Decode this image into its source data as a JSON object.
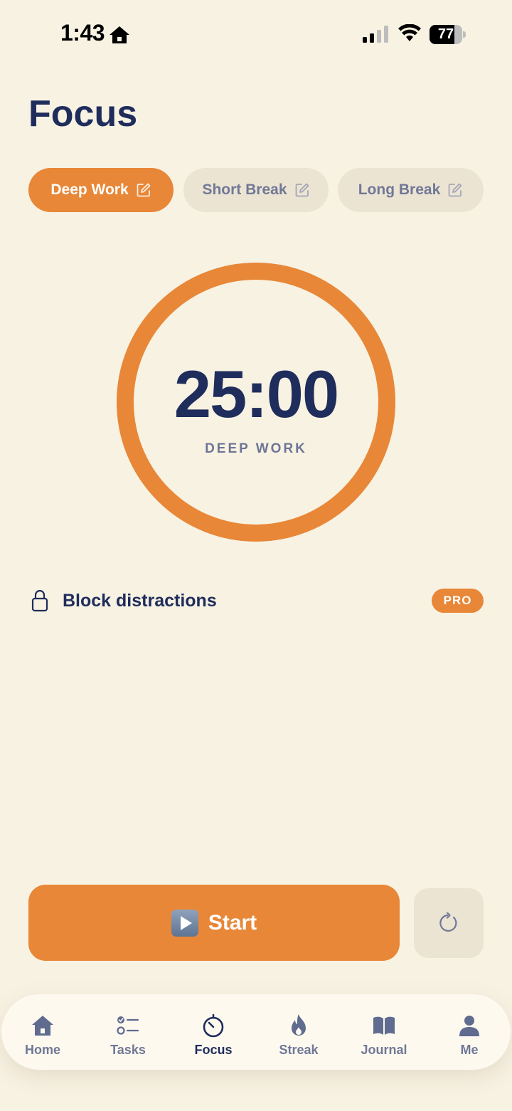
{
  "status_bar": {
    "time": "1:43",
    "battery_percent": 77,
    "battery_text": "77",
    "signal_bars_filled": 2,
    "signal_bars_total": 4
  },
  "page": {
    "title": "Focus"
  },
  "modes": [
    {
      "label": "Deep Work",
      "active": true
    },
    {
      "label": "Short Break",
      "active": false
    },
    {
      "label": "Long Break",
      "active": false
    }
  ],
  "timer": {
    "time": "25:00",
    "label": "DEEP WORK",
    "progress": 1.0
  },
  "block_distractions": {
    "label": "Block distractions",
    "badge": "PRO"
  },
  "actions": {
    "start_label": "Start"
  },
  "nav": [
    {
      "label": "Home",
      "icon": "home-icon",
      "active": false
    },
    {
      "label": "Tasks",
      "icon": "tasks-icon",
      "active": false
    },
    {
      "label": "Focus",
      "icon": "timer-icon",
      "active": true
    },
    {
      "label": "Streak",
      "icon": "flame-icon",
      "active": false
    },
    {
      "label": "Journal",
      "icon": "book-icon",
      "active": false
    },
    {
      "label": "Me",
      "icon": "person-icon",
      "active": false
    }
  ],
  "colors": {
    "background": "#F8F2E3",
    "accent": "#E88737",
    "navy": "#1F2D5C",
    "muted": "#707896",
    "pill_inactive": "#ECE4D3"
  }
}
